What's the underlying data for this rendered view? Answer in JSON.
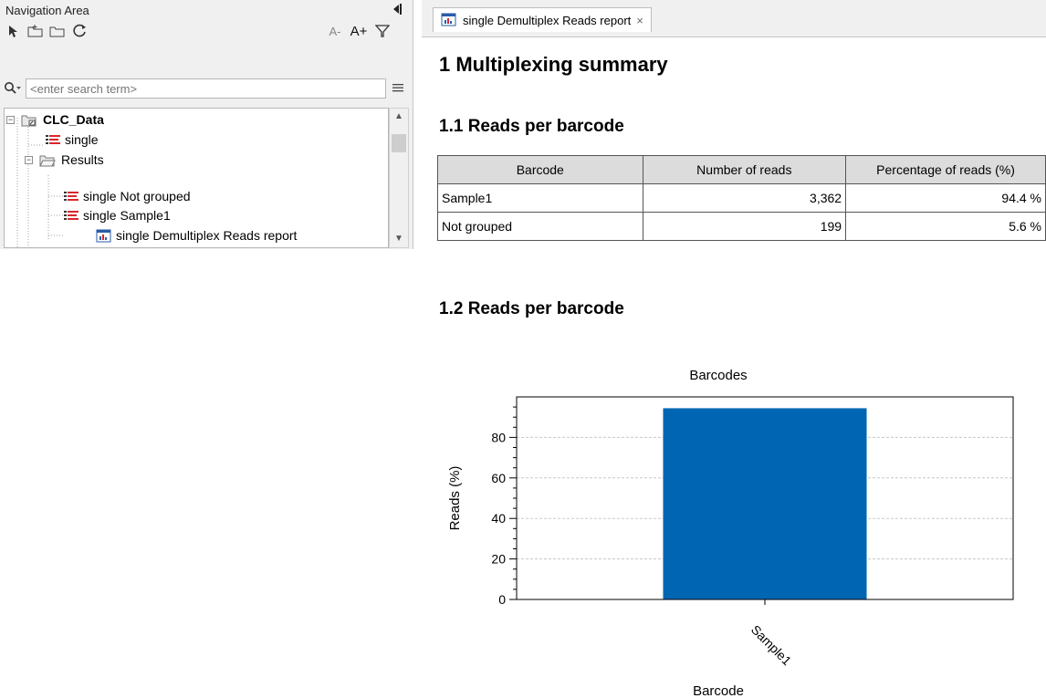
{
  "nav": {
    "title": "Navigation Area",
    "font_small": "A-",
    "font_large": "A+",
    "search": {
      "placeholder": "<enter search term>",
      "value": ""
    },
    "tree": [
      {
        "label": "CLC_Data",
        "bold": true,
        "icon": "folder-open-link-icon",
        "expander": "minus"
      },
      {
        "label": "single",
        "icon": "sequence-list-icon"
      },
      {
        "label": "Results",
        "icon": "folder-open-icon",
        "expander": "minus"
      },
      {
        "label": "single Not grouped",
        "icon": "sequence-list-icon"
      },
      {
        "label": "single Sample1",
        "icon": "sequence-list-icon"
      },
      {
        "label": "single Demultiplex Reads report",
        "icon": "report-icon"
      }
    ]
  },
  "editor": {
    "tab_label": "single Demultiplex Reads report",
    "close_glyph": "×"
  },
  "report": {
    "h1": "1 Multiplexing summary",
    "h1_1": "1.1 Reads per barcode",
    "h1_2": "1.2 Reads per barcode",
    "table": {
      "headers": [
        "Barcode",
        "Number of reads",
        "Percentage of reads (%)"
      ],
      "rows": [
        [
          "Sample1",
          "3,362",
          "94.4 %"
        ],
        [
          "Not grouped",
          "199",
          "5.6 %"
        ]
      ]
    }
  },
  "colors": {
    "bar": "#0066b3",
    "header_bg": "#dcdcdc",
    "seq_red": "#d9262c"
  },
  "chart_data": {
    "type": "bar",
    "title": "Barcodes",
    "xlabel": "Barcode",
    "ylabel": "Reads (%)",
    "categories": [
      "Sample1"
    ],
    "values": [
      94.4
    ],
    "ylim": [
      0,
      100
    ],
    "yticks": [
      "0",
      "20",
      "40",
      "60",
      "80"
    ],
    "grid": true
  }
}
